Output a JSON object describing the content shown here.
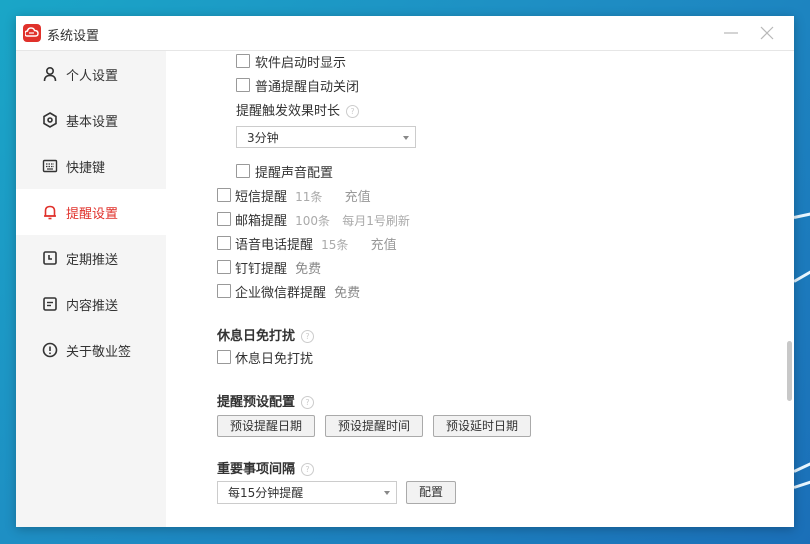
{
  "window": {
    "title": "系统设置"
  },
  "sidebar": {
    "items": [
      {
        "label": "个人设置",
        "icon": "user-icon",
        "active": false
      },
      {
        "label": "基本设置",
        "icon": "settings-icon",
        "active": false
      },
      {
        "label": "快捷键",
        "icon": "keyboard-icon",
        "active": false
      },
      {
        "label": "提醒设置",
        "icon": "bell-icon",
        "active": true
      },
      {
        "label": "定期推送",
        "icon": "calendar-icon",
        "active": false
      },
      {
        "label": "内容推送",
        "icon": "document-icon",
        "active": false
      },
      {
        "label": "关于敬业签",
        "icon": "info-icon",
        "active": false
      }
    ]
  },
  "reminders": {
    "show_on_start": "软件启动时显示",
    "auto_close": "普通提醒自动关闭",
    "trigger_duration_label": "提醒触发效果时长",
    "trigger_duration_value": "3分钟",
    "sound_config": "提醒声音配置",
    "sms": {
      "label": "短信提醒",
      "count": "11条",
      "action": "充值"
    },
    "email": {
      "label": "邮箱提醒",
      "count": "100条",
      "note": "每月1号刷新"
    },
    "voice": {
      "label": "语音电话提醒",
      "count": "15条",
      "action": "充值"
    },
    "dingtalk": {
      "label": "钉钉提醒",
      "note": "免费"
    },
    "wecom": {
      "label": "企业微信群提醒",
      "note": "免费"
    }
  },
  "dnd": {
    "title": "休息日免打扰",
    "option": "休息日免打扰"
  },
  "preset": {
    "title": "提醒预设配置",
    "buttons": [
      "预设提醒日期",
      "预设提醒时间",
      "预设延时日期"
    ]
  },
  "interval": {
    "title": "重要事项间隔",
    "value": "每15分钟提醒",
    "config_label": "配置"
  },
  "colors": {
    "accent": "#e0312b",
    "sidebar_bg": "#f5f5f5"
  }
}
